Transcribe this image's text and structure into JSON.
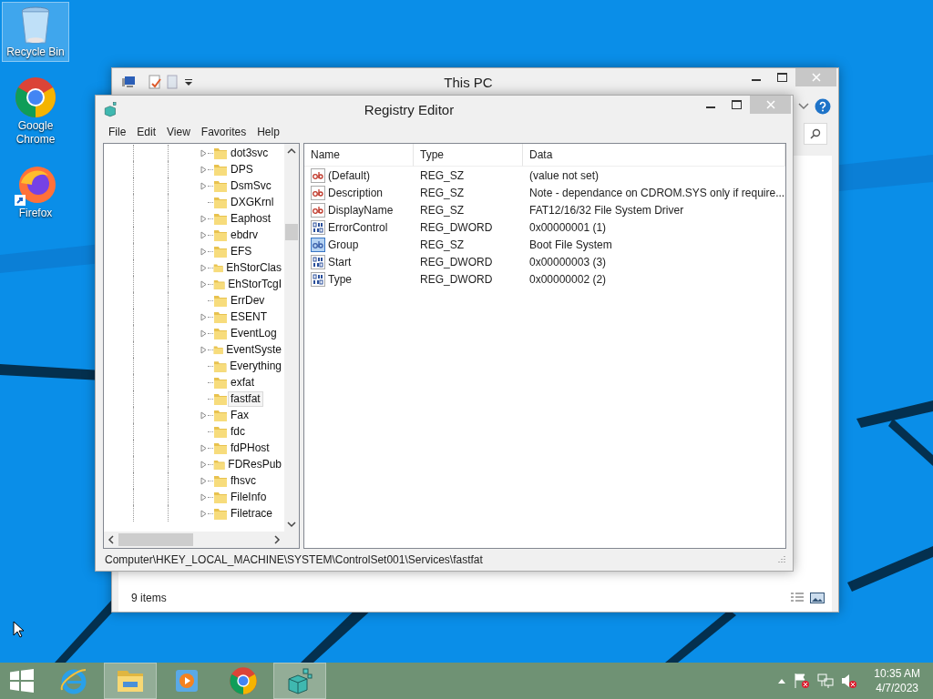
{
  "desktop_icons": [
    {
      "label": "Recycle Bin",
      "kind": "recycle",
      "selected": true
    },
    {
      "label": "Google Chrome",
      "kind": "chrome",
      "selected": false
    },
    {
      "label": "Firefox",
      "kind": "firefox",
      "selected": false
    }
  ],
  "explorer": {
    "title": "This PC",
    "status": "9 items"
  },
  "regedit": {
    "title": "Registry Editor",
    "menu": [
      "File",
      "Edit",
      "View",
      "Favorites",
      "Help"
    ],
    "tree": [
      {
        "name": "dot3svc",
        "expandable": true,
        "selected": false
      },
      {
        "name": "DPS",
        "expandable": true,
        "selected": false
      },
      {
        "name": "DsmSvc",
        "expandable": true,
        "selected": false
      },
      {
        "name": "DXGKrnl",
        "expandable": false,
        "selected": false
      },
      {
        "name": "Eaphost",
        "expandable": true,
        "selected": false
      },
      {
        "name": "ebdrv",
        "expandable": true,
        "selected": false
      },
      {
        "name": "EFS",
        "expandable": true,
        "selected": false
      },
      {
        "name": "EhStorClas",
        "expandable": true,
        "selected": false
      },
      {
        "name": "EhStorTcgI",
        "expandable": true,
        "selected": false
      },
      {
        "name": "ErrDev",
        "expandable": false,
        "selected": false
      },
      {
        "name": "ESENT",
        "expandable": true,
        "selected": false
      },
      {
        "name": "EventLog",
        "expandable": true,
        "selected": false
      },
      {
        "name": "EventSyste",
        "expandable": true,
        "selected": false
      },
      {
        "name": "Everything",
        "expandable": false,
        "selected": false
      },
      {
        "name": "exfat",
        "expandable": false,
        "selected": false
      },
      {
        "name": "fastfat",
        "expandable": false,
        "selected": true
      },
      {
        "name": "Fax",
        "expandable": true,
        "selected": false
      },
      {
        "name": "fdc",
        "expandable": false,
        "selected": false
      },
      {
        "name": "fdPHost",
        "expandable": true,
        "selected": false
      },
      {
        "name": "FDResPub",
        "expandable": true,
        "selected": false
      },
      {
        "name": "fhsvc",
        "expandable": true,
        "selected": false
      },
      {
        "name": "FileInfo",
        "expandable": true,
        "selected": false
      },
      {
        "name": "Filetrace",
        "expandable": true,
        "selected": false
      }
    ],
    "columns": [
      "Name",
      "Type",
      "Data"
    ],
    "values": [
      {
        "name": "(Default)",
        "type": "REG_SZ",
        "data": "(value not set)",
        "kind": "string",
        "selected": false
      },
      {
        "name": "Description",
        "type": "REG_SZ",
        "data": "Note - dependance on CDROM.SYS only if require...",
        "kind": "string",
        "selected": false
      },
      {
        "name": "DisplayName",
        "type": "REG_SZ",
        "data": "FAT12/16/32 File System Driver",
        "kind": "string",
        "selected": false
      },
      {
        "name": "ErrorControl",
        "type": "REG_DWORD",
        "data": "0x00000001 (1)",
        "kind": "binary",
        "selected": false
      },
      {
        "name": "Group",
        "type": "REG_SZ",
        "data": "Boot File System",
        "kind": "string",
        "selected": true
      },
      {
        "name": "Start",
        "type": "REG_DWORD",
        "data": "0x00000003 (3)",
        "kind": "binary",
        "selected": false
      },
      {
        "name": "Type",
        "type": "REG_DWORD",
        "data": "0x00000002 (2)",
        "kind": "binary",
        "selected": false
      }
    ],
    "status_path": "Computer\\HKEY_LOCAL_MACHINE\\SYSTEM\\ControlSet001\\Services\\fastfat"
  },
  "taskbar": {
    "apps": [
      {
        "kind": "ie",
        "active": false
      },
      {
        "kind": "explorer",
        "active": true
      },
      {
        "kind": "media",
        "active": false
      },
      {
        "kind": "chrome",
        "active": false
      },
      {
        "kind": "regedit",
        "active": true
      }
    ],
    "time": "10:35 AM",
    "date": "4/7/2023"
  }
}
